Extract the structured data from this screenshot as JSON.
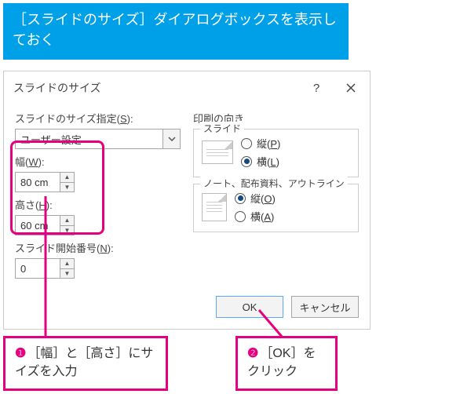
{
  "banner": {
    "text": "［スライドのサイズ］ダイアログボックスを表示しておく"
  },
  "dialog": {
    "title": "スライドのサイズ",
    "help_tooltip": "?",
    "close_tooltip": "閉じる",
    "sizeSpec": {
      "label_pre": "スライドのサイズ指定(",
      "accel": "S",
      "label_post": "):",
      "value": "ユーザー設定"
    },
    "width": {
      "label_pre": "幅(",
      "accel": "W",
      "label_post": "):",
      "value": "80 cm"
    },
    "height": {
      "label_pre": "高さ(",
      "accel": "H",
      "label_post": "):",
      "value": "60 cm"
    },
    "startNumber": {
      "label_pre": "スライド開始番号(",
      "accel": "N",
      "label_post": "):",
      "value": "0"
    },
    "orientation": {
      "heading": "印刷の向き",
      "slides": {
        "legend": "スライド",
        "portrait": {
          "label_pre": "縦(",
          "accel": "P",
          "label_post": ")",
          "checked": false
        },
        "landscape": {
          "label_pre": "横(",
          "accel": "L",
          "label_post": ")",
          "checked": true
        }
      },
      "notes": {
        "legend": "ノート、配布資料、アウトライン",
        "portrait": {
          "label_pre": "縦(",
          "accel": "O",
          "label_post": ")",
          "checked": true
        },
        "landscape": {
          "label_pre": "横(",
          "accel": "A",
          "label_post": ")",
          "checked": false
        }
      }
    },
    "buttons": {
      "ok": "OK",
      "cancel": "キャンセル"
    }
  },
  "callouts": {
    "c1": {
      "num": "❶",
      "text": "［幅］と［高さ］にサイズを入力"
    },
    "c2": {
      "num": "❷",
      "text": "［OK］をクリック"
    }
  }
}
